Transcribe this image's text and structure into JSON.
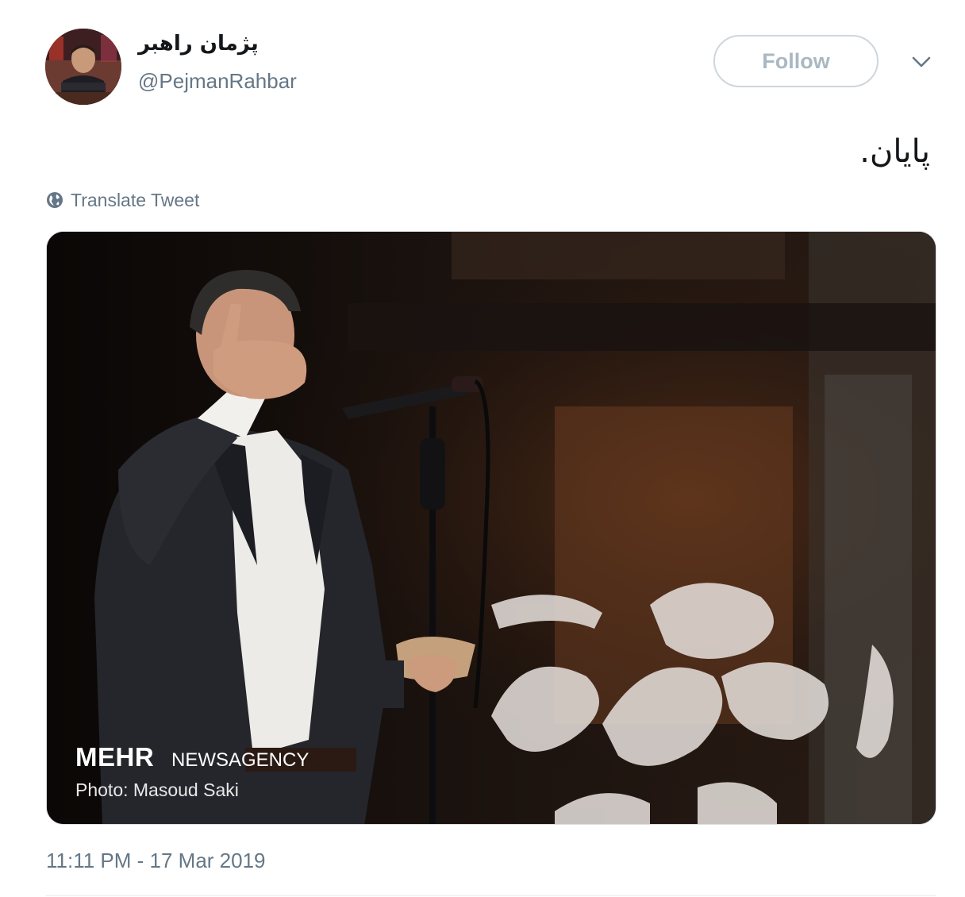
{
  "author": {
    "display_name": "پژمان راهبر",
    "handle": "@PejmanRahbar",
    "avatar_icon": "user-avatar"
  },
  "follow_label": "Follow",
  "menu_icon": "chevron-down-icon",
  "tweet_text": "پایان.",
  "translate": {
    "icon": "globe-icon",
    "label": "Translate Tweet"
  },
  "media": {
    "watermark_brand": "MEHR",
    "watermark_agency": "NEWSAGENCY",
    "photo_credit": "Photo: Masoud Saki"
  },
  "timestamp": "11:11 PM - 17 Mar 2019",
  "colors": {
    "secondary_text": "#657786",
    "follow_border": "#cfd6db",
    "follow_text": "#aab8c2"
  }
}
